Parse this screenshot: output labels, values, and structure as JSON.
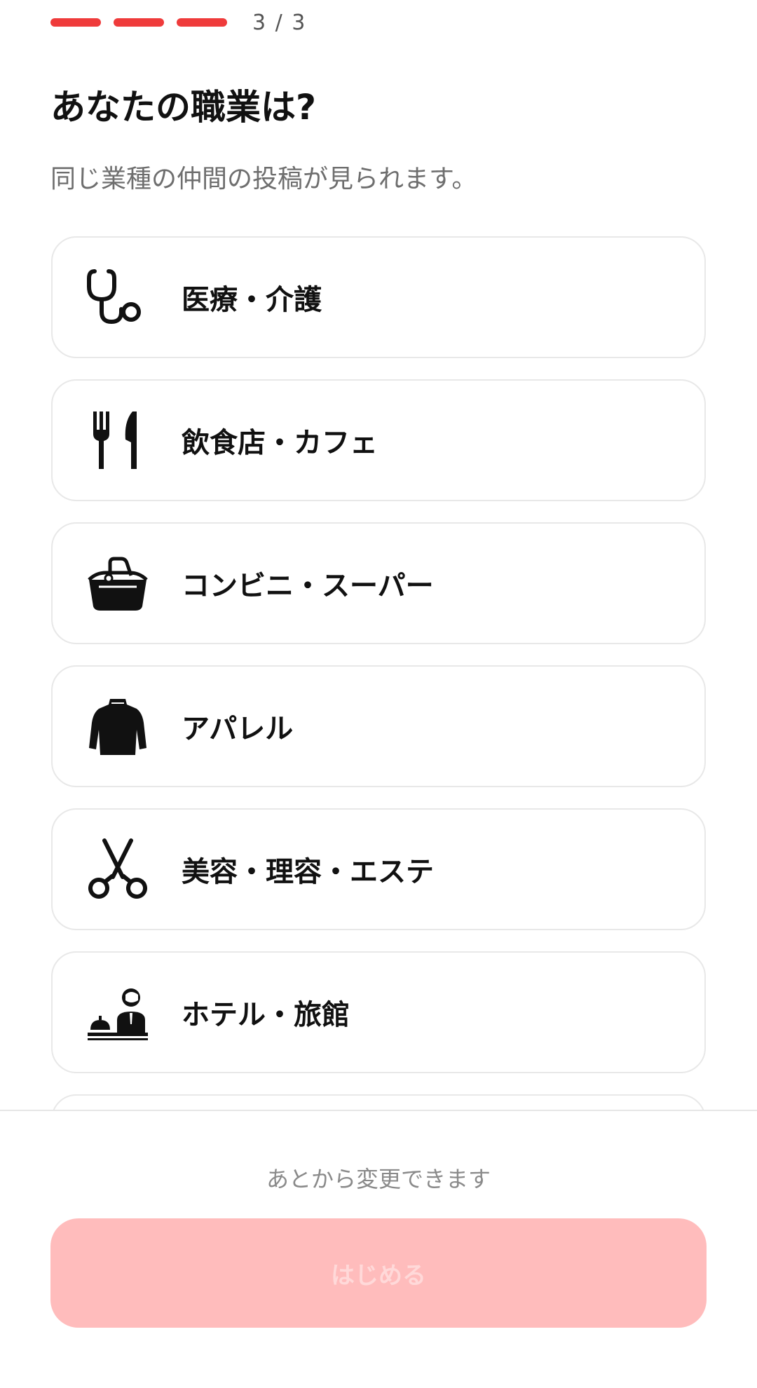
{
  "progress": {
    "count_text": "3 / 3",
    "segment_color": "#ef3b3b"
  },
  "header": {
    "title": "あなたの職業は?",
    "subtitle": "同じ業種の仲間の投稿が見られます。"
  },
  "options": [
    {
      "label": "医療・介護",
      "icon": "stethoscope-icon"
    },
    {
      "label": "飲食店・カフェ",
      "icon": "fork-knife-icon"
    },
    {
      "label": "コンビニ・スーパー",
      "icon": "shopping-basket-icon"
    },
    {
      "label": "アパレル",
      "icon": "jacket-icon"
    },
    {
      "label": "美容・理容・エステ",
      "icon": "scissors-icon"
    },
    {
      "label": "ホテル・旅館",
      "icon": "hotel-reception-icon"
    }
  ],
  "footer": {
    "note": "あとから変更できます",
    "start_label": "はじめる",
    "start_button_color": "#ffbcbc"
  }
}
